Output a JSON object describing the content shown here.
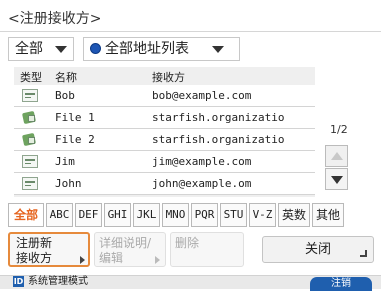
{
  "title": "<注册接收方>",
  "filters": {
    "type_value": "全部",
    "address_book_value": "全部地址列表"
  },
  "table": {
    "headers": {
      "type": "类型",
      "name": "名称",
      "recipient": "接收方"
    },
    "rows": [
      {
        "icon": "email-icon",
        "name": "Bob",
        "address": "bob@example.com"
      },
      {
        "icon": "file-icon",
        "name": "File 1",
        "address": "starfish.organizatio"
      },
      {
        "icon": "file-icon",
        "name": "File 2",
        "address": "starfish.organizatio"
      },
      {
        "icon": "email-icon",
        "name": "Jim",
        "address": "jim@example.com"
      },
      {
        "icon": "email-icon",
        "name": "John",
        "address": "john@example.om"
      }
    ]
  },
  "paging": {
    "page": "1/2"
  },
  "index_tabs": [
    "全部",
    "ABC",
    "DEF",
    "GHI",
    "JKL",
    "MNO",
    "PQR",
    "STU",
    "V-Z",
    "英数",
    "其他"
  ],
  "actions": {
    "register_line1": "注册新",
    "register_line2": "接收方",
    "detail_line1": "详细说明/",
    "detail_line2": "编辑",
    "delete": "删除",
    "close": "关闭"
  },
  "status_bar": {
    "mode_icon": "ID",
    "mode": "系统管理模式",
    "logout": "注销"
  },
  "colors": {
    "accent": "#e6641e",
    "blue": "#1f5fae"
  }
}
